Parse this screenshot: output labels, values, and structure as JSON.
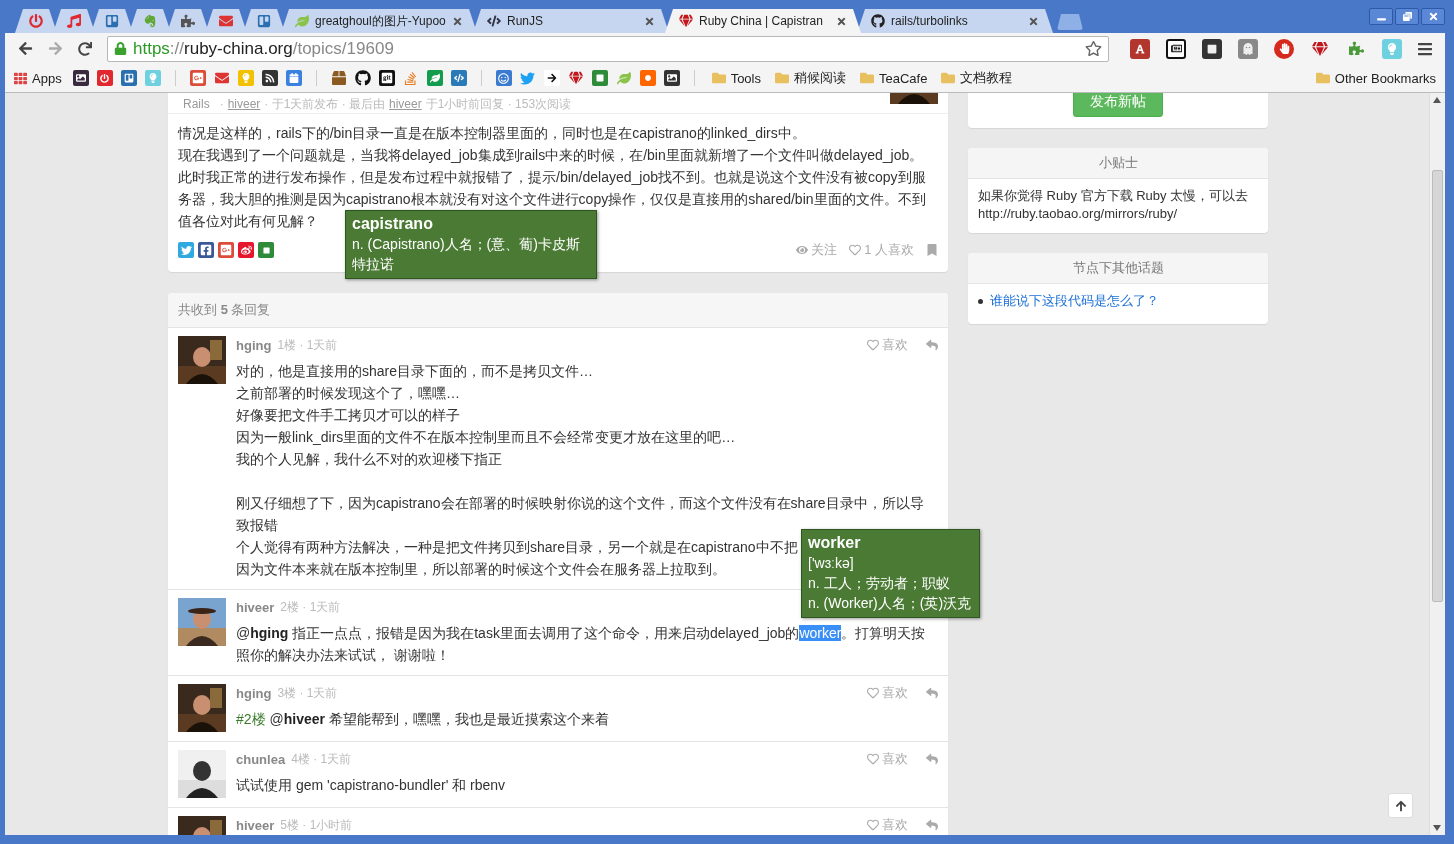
{
  "browser": {
    "tabs": [
      {
        "kind": "pinned",
        "selected": false
      },
      {
        "kind": "pinned",
        "selected": false
      },
      {
        "kind": "pinned",
        "selected": false
      },
      {
        "kind": "pinned",
        "selected": false
      },
      {
        "kind": "pinned",
        "selected": false
      },
      {
        "kind": "pinned",
        "selected": false
      },
      {
        "kind": "pinned",
        "selected": false
      },
      {
        "kind": "page",
        "title": "greatghoul的图片-Yupoo",
        "selected": false
      },
      {
        "kind": "page",
        "title": "RunJS",
        "selected": false
      },
      {
        "kind": "page",
        "title": "Ruby China | Capistran",
        "selected": true
      },
      {
        "kind": "page",
        "title": "rails/turbolinks",
        "selected": false
      }
    ],
    "address": {
      "scheme": "https",
      "separator": "://",
      "host": "ruby-china.org",
      "path": "/topics/19609"
    },
    "bookmarks": {
      "apps": "Apps",
      "folders": [
        "Tools",
        "稍候阅读",
        "TeaCafe",
        "文档教程"
      ],
      "other": "Other Bookmarks"
    }
  },
  "topic": {
    "meta": {
      "node": "Rails",
      "sep": "·",
      "author": "hiveer",
      "posted": "· 于1天前发布 · 最后由",
      "last_user": "hiveer",
      "last": "于1小时前回复 · 153次阅读"
    },
    "body": [
      "情况是这样的，rails下的/bin目录一直是在版本控制器里面的，同时也是在capistrano的linked_dirs中。",
      "现在我遇到了一个问题就是，当我将delayed_job集成到rails中来的时候，在/bin里面就新增了一个文件叫做delayed_job。",
      "此时我正常的进行发布操作，但是发布过程中就报错了，提示/bin/delayed_job找不到。也就是说这个文件没有被copy到服",
      "务器，我大胆的推测是因为capistrano根本就没有对这个文件进行copy操作，仅仅是直接用的shared/bin里面的文件。不到",
      "值各位对此有何见解？"
    ],
    "follow": "关注",
    "likes": "1 人喜欢"
  },
  "replies_header": "共收到 **5** 条回复",
  "replies": [
    {
      "author": "hging",
      "floor": "1楼",
      "time": "· 1天前",
      "like": "喜欢",
      "lines": [
        {
          "kind": "text",
          "text": "对的，他是直接用的share目录下面的，而不是拷贝文件…"
        },
        {
          "kind": "text",
          "text": "之前部署的时候发现这个了，嘿嘿…"
        },
        {
          "kind": "text",
          "text": "好像要把文件手工拷贝才可以的样子"
        },
        {
          "kind": "text",
          "text": "因为一般link_dirs里面的文件不在版本控制里而且不会经常变更才放在这里的吧…"
        },
        {
          "kind": "text",
          "text": "我的个人见解，我什么不对的欢迎楼下指正"
        },
        {
          "kind": "gap"
        },
        {
          "kind": "text",
          "text": "刚又仔细想了下，因为capistrano会在部署的时候映射你说的这个文件，而这个文件没有在share目录中，所以导"
        },
        {
          "kind": "text",
          "text": "致报错"
        },
        {
          "kind": "text",
          "text": "个人觉得有两种方法解决，一种是把文件拷贝到share目录，另一个就是在capistrano中不把"
        },
        {
          "kind": "text",
          "text": "因为文件本来就在版本控制里，所以部署的时候这个文件会在服务器上拉取到。"
        }
      ]
    },
    {
      "author": "hiveer",
      "floor": "2楼",
      "time": "· 1天前",
      "lines": [
        {
          "kind": "runs",
          "runs": [
            {
              "kind": "plain",
              "text": "@"
            },
            {
              "kind": "mention",
              "text": "hging"
            },
            {
              "kind": "plain",
              "text": " 指正一点点，报错是因为我在task里面去调用了这个命令，用来启动delayed_job的"
            },
            {
              "kind": "selected",
              "text": "worker"
            },
            {
              "kind": "plain",
              "text": "。打算明天按"
            }
          ]
        },
        {
          "kind": "text",
          "text": "照你的解决办法来试试， 谢谢啦！"
        }
      ]
    },
    {
      "author": "hging",
      "floor": "3楼",
      "time": "· 1天前",
      "like": "喜欢",
      "lines": [
        {
          "kind": "runs",
          "runs": [
            {
              "kind": "floor",
              "text": "#2楼"
            },
            {
              "kind": "plain",
              "text": " @"
            },
            {
              "kind": "mention",
              "text": "hiveer"
            },
            {
              "kind": "plain",
              "text": " 希望能帮到，嘿嘿，我也是最近摸索这个来着"
            }
          ]
        }
      ]
    },
    {
      "author": "chunlea",
      "floor": "4楼",
      "time": "· 1天前",
      "like": "喜欢",
      "lines": [
        {
          "kind": "text",
          "text": "试试使用 gem 'capistrano-bundler' 和 rbenv"
        }
      ]
    },
    {
      "author": "hiveer",
      "floor": "5楼",
      "time": "· 1小时前",
      "like": "喜欢"
    }
  ],
  "sidebar": {
    "new_topic": "发布新帖",
    "tips": {
      "title": "小贴士",
      "text": "如果你觉得 Ruby 官方下载 Ruby 太慢，可以去 http://ruby.taobao.org/mirrors/ruby/"
    },
    "node_topics": {
      "title": "节点下其他话题",
      "items": [
        "谁能说下这段代码是怎么了？"
      ]
    }
  },
  "tooltips": [
    {
      "word": "capistrano",
      "defs": [
        "n. (Capistrano)人名；(意、葡)卡皮斯特拉诺"
      ]
    },
    {
      "word": "worker",
      "phonetic": "['wɜːkə]",
      "defs": [
        "n. 工人；劳动者；职蚁",
        "n. (Worker)人名；(英)沃克"
      ]
    }
  ]
}
